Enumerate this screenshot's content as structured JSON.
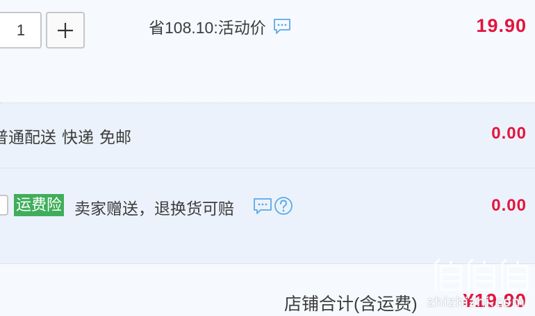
{
  "quantity": {
    "value": "1",
    "plus_icon": "plus-icon"
  },
  "item": {
    "promo_text": "省108.10:活动价",
    "price": "19.90",
    "chat_icon": "chat-bubble-icon"
  },
  "shipping": {
    "method": "普通配送",
    "carrier": "快递",
    "free_label": "免邮",
    "fee": "0.00"
  },
  "insurance": {
    "badge": "运费险",
    "description": "卖家赠送，退换货可赔",
    "fee": "0.00",
    "icons": [
      "chat-bubble-icon",
      "help-circle-icon"
    ],
    "badge_color": "#3fae5a"
  },
  "total": {
    "label": "店铺合计(含运费)",
    "value": "¥19.90"
  },
  "watermark": {
    "logo": "值值值",
    "text": "zhizhizhi.com"
  },
  "colors": {
    "price_red": "#e3143c",
    "icon_blue": "#5aa9e6",
    "background": "#f6f9fe",
    "row_band": "#ecf2fb"
  }
}
